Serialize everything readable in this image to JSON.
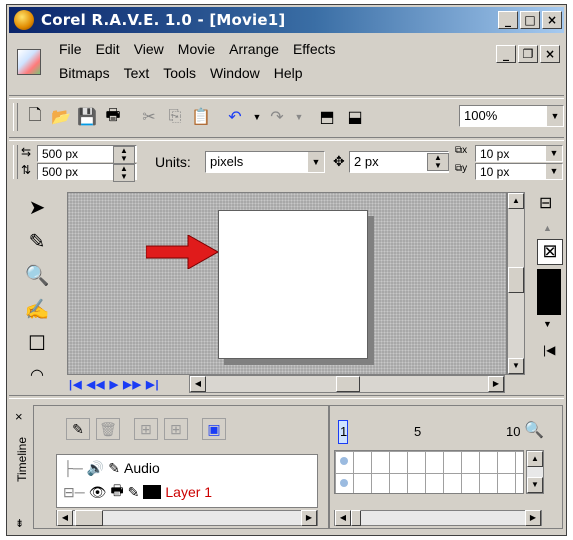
{
  "window": {
    "title": "Corel R.A.V.E. 1.0 - [Movie1]",
    "controls": {
      "minimize": "_",
      "maximize": "□",
      "close": "×"
    },
    "mdi_controls": {
      "minimize": "_",
      "restore": "❐",
      "close": "×"
    }
  },
  "menu": {
    "row1": [
      "File",
      "Edit",
      "View",
      "Movie",
      "Arrange",
      "Effects"
    ],
    "row2": [
      "Bitmaps",
      "Text",
      "Tools",
      "Window",
      "Help"
    ]
  },
  "toolbar": {
    "zoom": "100%",
    "icons": [
      "new-icon",
      "open-icon",
      "save-icon",
      "print-icon",
      "cut-icon",
      "copy-icon",
      "paste-icon",
      "undo-icon",
      "redo-icon",
      "import-icon",
      "export-icon"
    ]
  },
  "property_bar": {
    "width": "500 px",
    "height": "500 px",
    "units_label": "Units:",
    "units_value": "pixels",
    "nudge": "2 px",
    "dup_x": "10 px",
    "dup_y": "10 px"
  },
  "stage": {
    "playback_symbols": "|◀ ◀◀ ▶ ▶▶ ▶|",
    "arrow_color": "#e01b1b"
  },
  "timeline": {
    "label": "Timeline",
    "frame_marks": [
      "1",
      "5",
      "10"
    ],
    "layers": [
      {
        "name": "Audio",
        "color": "#000000"
      },
      {
        "name": "Layer 1",
        "color": "#cc0000"
      }
    ]
  }
}
